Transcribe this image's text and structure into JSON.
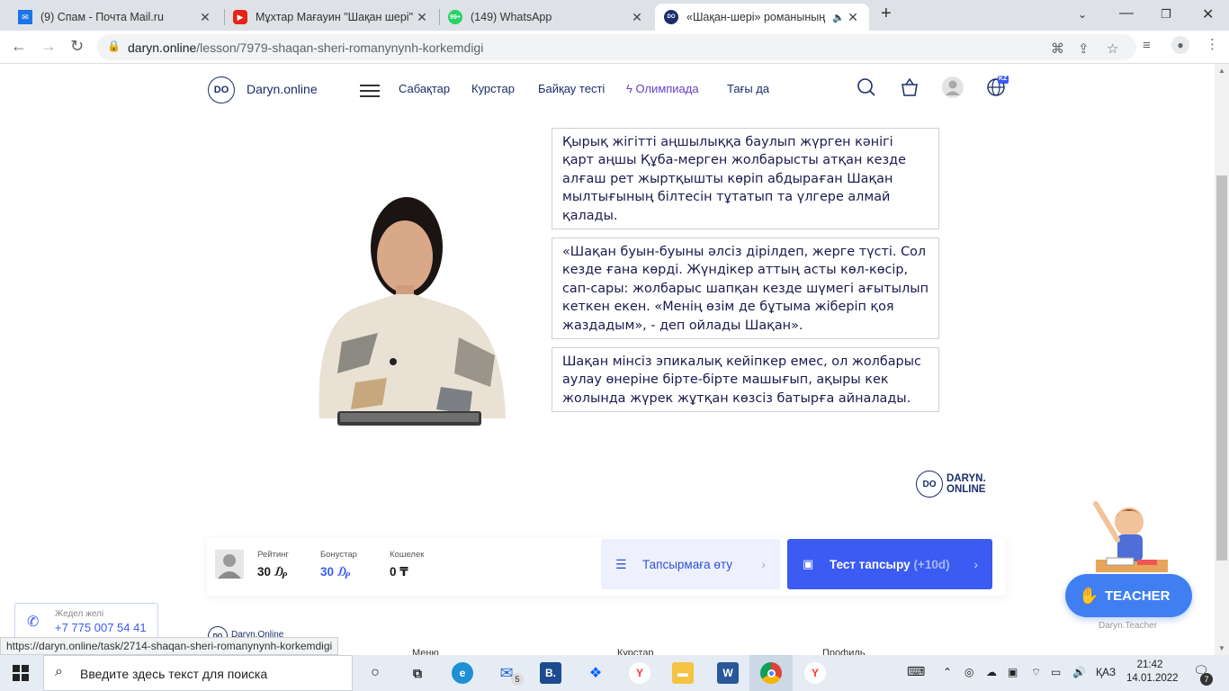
{
  "browser": {
    "tabs": [
      {
        "title": "(9) Спам - Почта Mail.ru",
        "icon": "mail-icon"
      },
      {
        "title": "Мұхтар Мағауин \"Шақан шері\" |",
        "icon": "youtube-icon"
      },
      {
        "title": "(149) WhatsApp",
        "icon": "whatsapp-icon"
      },
      {
        "title": "«Шақан-шері» романының",
        "icon": "daryn-icon"
      }
    ],
    "url_domain": "daryn.online",
    "url_path": "/lesson/7979-shaqan-sheri-romanynynh-korkemdigi",
    "status_url": "https://daryn.online/task/2714-shaqan-sheri-romanynynh-korkemdigi"
  },
  "site": {
    "logo_text": "DO",
    "name": "Daryn.online",
    "nav": [
      "Сабақтар",
      "Курстар",
      "Байқау тесті",
      "Олимпиада",
      "Тағы да"
    ],
    "lang_badge": "KZ"
  },
  "lesson": {
    "cards": [
      "Қырық жігітті аңшылыққа баулып жүрген кәнігі қарт аңшы Құба-мерген жолбарысты атқан кезде алғаш рет жыртқышты көріп абдыраған Шақан мылтығының білтесін тұтатып та үлгере алмай қалады.",
      "«Шақан буын-буыны әлсіз дірілдеп, жерге түсті. Сол кезде ғана көрді. Жүндікер аттың асты көл-көсір, сап-сары: жолбарыс шапқан кезде шүмегі ағытылып кеткен екен. «Менің өзім де бұтыма жіберіп қоя жаздадым», - деп ойлады Шақан».",
      "Шақан мінсіз эпикалық кейіпкер емес, ол жолбарыс аулау өнеріне бірте-бірте машығып, ақыры кек жолында жүрек жұтқан көзсіз батырға айналады."
    ],
    "brand_line1": "DARYN.",
    "brand_line2": "ONLINE"
  },
  "stats": {
    "rating_label": "Рейтинг",
    "rating_value": "30 ₯",
    "bonus_label": "Бонустар",
    "bonus_value": "30 ₯",
    "wallet_label": "Кошелек",
    "wallet_value": "0 ₸",
    "task_button": "Тапсырмаға өту",
    "test_button": "Тест тапсыру",
    "test_bonus": "(+10d)"
  },
  "hotline": {
    "label": "Жедел желі",
    "phone": "+7 775 007 54 41"
  },
  "footer": {
    "logo": "Daryn.Online",
    "menu": "Меню",
    "courses": "Курстар",
    "profile": "Профиль"
  },
  "teacher": {
    "button": "TEACHER",
    "caption": "Daryn.Teacher"
  },
  "taskbar": {
    "search_placeholder": "Введите здесь текст для поиска",
    "mail_badge": "5",
    "lang": "ҚАЗ",
    "time": "21:42",
    "date": "14.01.2022",
    "notif": "7"
  }
}
